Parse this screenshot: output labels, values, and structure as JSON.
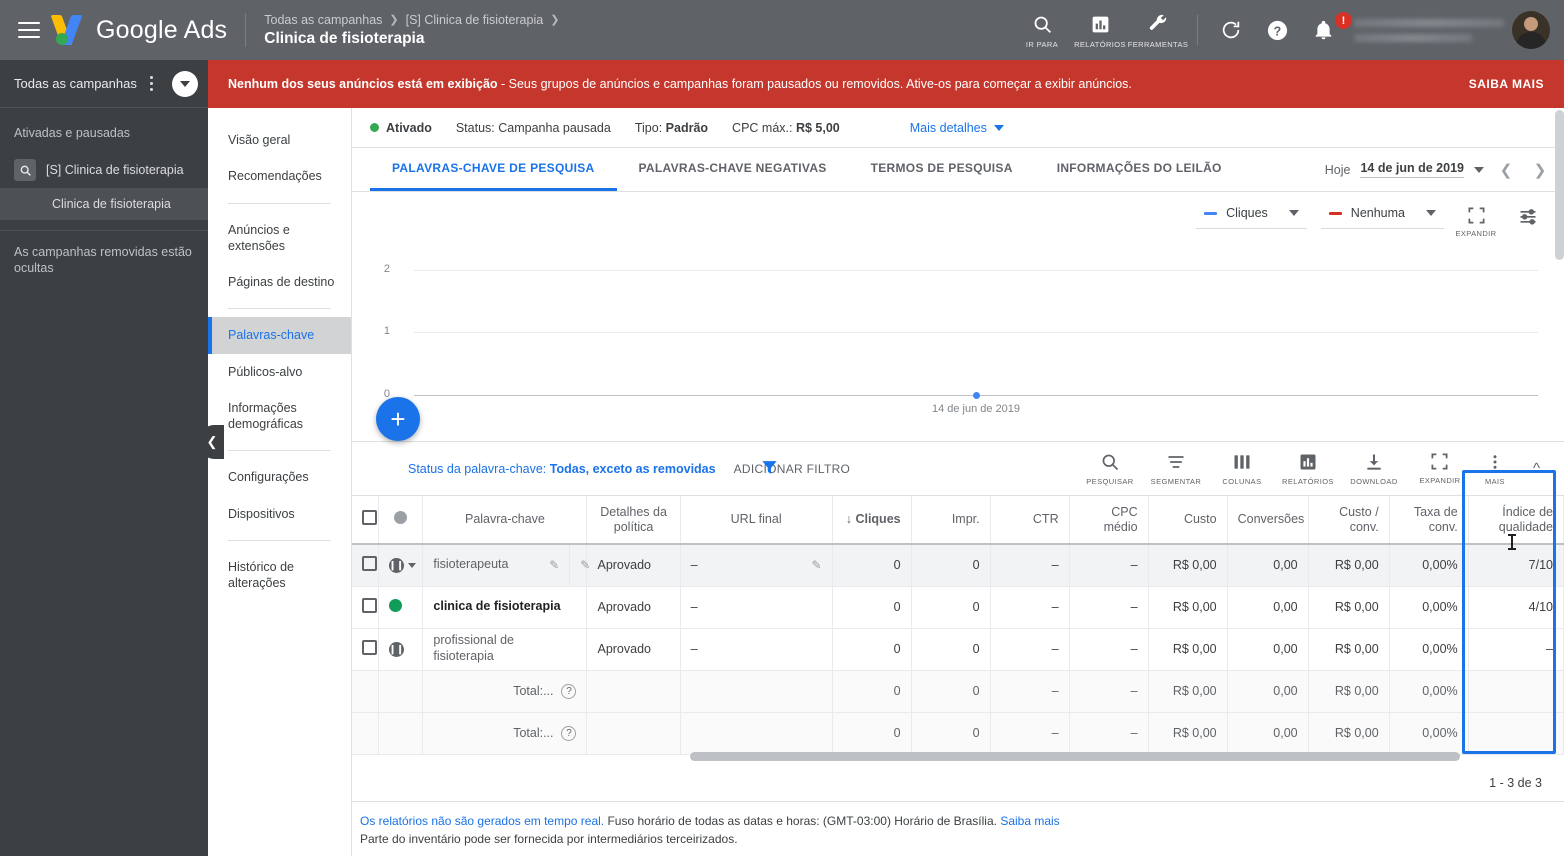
{
  "topbar": {
    "product": "Google Ads",
    "breadcrumbs": [
      "Todas as campanhas",
      "[S] Clinica de fisioterapia"
    ],
    "title": "Clinica de fisioterapia",
    "tools": [
      {
        "label": "IR PARA",
        "icon": "search-icon"
      },
      {
        "label": "RELATÓRIOS",
        "icon": "reports-icon"
      },
      {
        "label": "FERRAMENTAS",
        "icon": "wrench-icon"
      }
    ],
    "notification_count": "!",
    "icons": [
      "refresh-icon",
      "help-icon",
      "bell-icon"
    ]
  },
  "alert": {
    "headline": "Nenhum dos seus anúncios está em exibição",
    "body": " - Seus grupos de anúncios e campanhas foram pausados ou removidos. Ative-os para começar a exibir anúncios.",
    "action": "SAIBA MAIS",
    "color": "#c5372c"
  },
  "left_panel": {
    "header": "Todas as campanhas",
    "group_label": "Ativadas e pausadas",
    "campaign": "[S] Clinica de fisioterapia",
    "adgroup": "Clinica de fisioterapia",
    "footer": "As campanhas removidas estão ocultas"
  },
  "nav": {
    "items": [
      {
        "label": "Visão geral",
        "active": false
      },
      {
        "label": "Recomendações",
        "active": false
      },
      {
        "label": "Anúncios e extensões",
        "active": false
      },
      {
        "label": "Páginas de destino",
        "active": false
      },
      {
        "label": "Palavras-chave",
        "active": true
      },
      {
        "label": "Públicos-alvo",
        "active": false
      },
      {
        "label": "Informações demográficas",
        "active": false
      },
      {
        "label": "Configurações",
        "active": false
      },
      {
        "label": "Dispositivos",
        "active": false
      },
      {
        "label": "Histórico de alterações",
        "active": false
      }
    ]
  },
  "status_bar": {
    "state": "Ativado",
    "status_label": "Status:",
    "status_value": "Campanha pausada",
    "type_label": "Tipo:",
    "type_value": "Padrão",
    "cpc_label": "CPC máx.:",
    "cpc_value": "R$ 5,00",
    "more": "Mais detalhes"
  },
  "tabs": [
    {
      "label": "PALAVRAS-CHAVE DE PESQUISA",
      "active": true
    },
    {
      "label": "PALAVRAS-CHAVE NEGATIVAS",
      "active": false
    },
    {
      "label": "TERMOS DE PESQUISA",
      "active": false
    },
    {
      "label": "INFORMAÇÕES DO LEILÃO",
      "active": false
    }
  ],
  "date_range": {
    "prefix": "Hoje",
    "value": "14 de jun de 2019"
  },
  "chart_controls": {
    "metric_primary": "Cliques",
    "metric_secondary": "Nenhuma",
    "primary_color": "#4285f4",
    "secondary_color": "#d93025",
    "expand_label": "EXPANDIR"
  },
  "chart_data": {
    "type": "line",
    "title": "",
    "x": [
      "14 de jun de 2019"
    ],
    "series": [
      {
        "name": "Cliques",
        "values": [
          0
        ],
        "color": "#4285f4"
      }
    ],
    "yticks": [
      0,
      1,
      2
    ],
    "ylim": [
      0,
      2
    ],
    "xlabel": "",
    "ylabel": "",
    "grid": true,
    "legend_position": "top-right"
  },
  "filter_bar": {
    "label": "Status da palavra-chave:",
    "value": "Todas, exceto as removidas",
    "add_filter": "ADICIONAR FILTRO",
    "tools": [
      {
        "label": "PESQUISAR",
        "icon": "search-icon"
      },
      {
        "label": "SEGMENTAR",
        "icon": "segment-icon"
      },
      {
        "label": "COLUNAS",
        "icon": "columns-icon"
      },
      {
        "label": "RELATÓRIOS",
        "icon": "reports-icon"
      },
      {
        "label": "DOWNLOAD",
        "icon": "download-icon"
      },
      {
        "label": "EXPANDIR",
        "icon": "expand-icon"
      },
      {
        "label": "MAIS",
        "icon": "more-vert-icon"
      }
    ]
  },
  "table": {
    "headers": [
      "Palavra-chave",
      "Detalhes da política",
      "URL final",
      "Cliques",
      "Impr.",
      "CTR",
      "CPC médio",
      "Custo",
      "Conversões",
      "Custo / conv.",
      "Taxa de conv.",
      "Índice de qualidade"
    ],
    "sort_column": "Cliques",
    "sort_direction": "desc",
    "highlight_column": "Índice de qualidade",
    "highlight_color": "#1a73e8",
    "rows": [
      {
        "keyword": "fisioterapeuta",
        "state": "paused",
        "hovered": true,
        "policy": "Aprovado",
        "final_url": "–",
        "clicks": "0",
        "impressions": "0",
        "ctr": "–",
        "avg_cpc": "–",
        "cost": "R$ 0,00",
        "conversions": "0,00",
        "cost_conv": "R$ 0,00",
        "conv_rate": "0,00%",
        "quality_score": "7/10"
      },
      {
        "keyword": "clinica de fisioterapia",
        "state": "active",
        "hovered": false,
        "policy": "Aprovado",
        "final_url": "–",
        "clicks": "0",
        "impressions": "0",
        "ctr": "–",
        "avg_cpc": "–",
        "cost": "R$ 0,00",
        "conversions": "0,00",
        "cost_conv": "R$ 0,00",
        "conv_rate": "0,00%",
        "quality_score": "4/10"
      },
      {
        "keyword": "profissional de fisioterapia",
        "state": "paused",
        "hovered": false,
        "policy": "Aprovado",
        "final_url": "–",
        "clicks": "0",
        "impressions": "0",
        "ctr": "–",
        "avg_cpc": "–",
        "cost": "R$ 0,00",
        "conversions": "0,00",
        "cost_conv": "R$ 0,00",
        "conv_rate": "0,00%",
        "quality_score": "–"
      }
    ],
    "totals": [
      {
        "label": "Total:...",
        "clicks": "0",
        "impressions": "0",
        "ctr": "–",
        "avg_cpc": "–",
        "cost": "R$ 0,00",
        "conversions": "0,00",
        "cost_conv": "R$ 0,00",
        "conv_rate": "0,00%"
      },
      {
        "label": "Total:...",
        "clicks": "0",
        "impressions": "0",
        "ctr": "–",
        "avg_cpc": "–",
        "cost": "R$ 0,00",
        "conversions": "0,00",
        "cost_conv": "R$ 0,00",
        "conv_rate": "0,00%"
      }
    ],
    "pager": "1 - 3 de 3"
  },
  "footnote": {
    "link1": "Os relatórios não são gerados em tempo real.",
    "text1": " Fuso horário de todas as datas e horas: (GMT-03:00) Horário de Brasília. ",
    "link2": "Saiba mais",
    "text2": "Parte do inventário pode ser fornecida por intermediários terceirizados."
  }
}
